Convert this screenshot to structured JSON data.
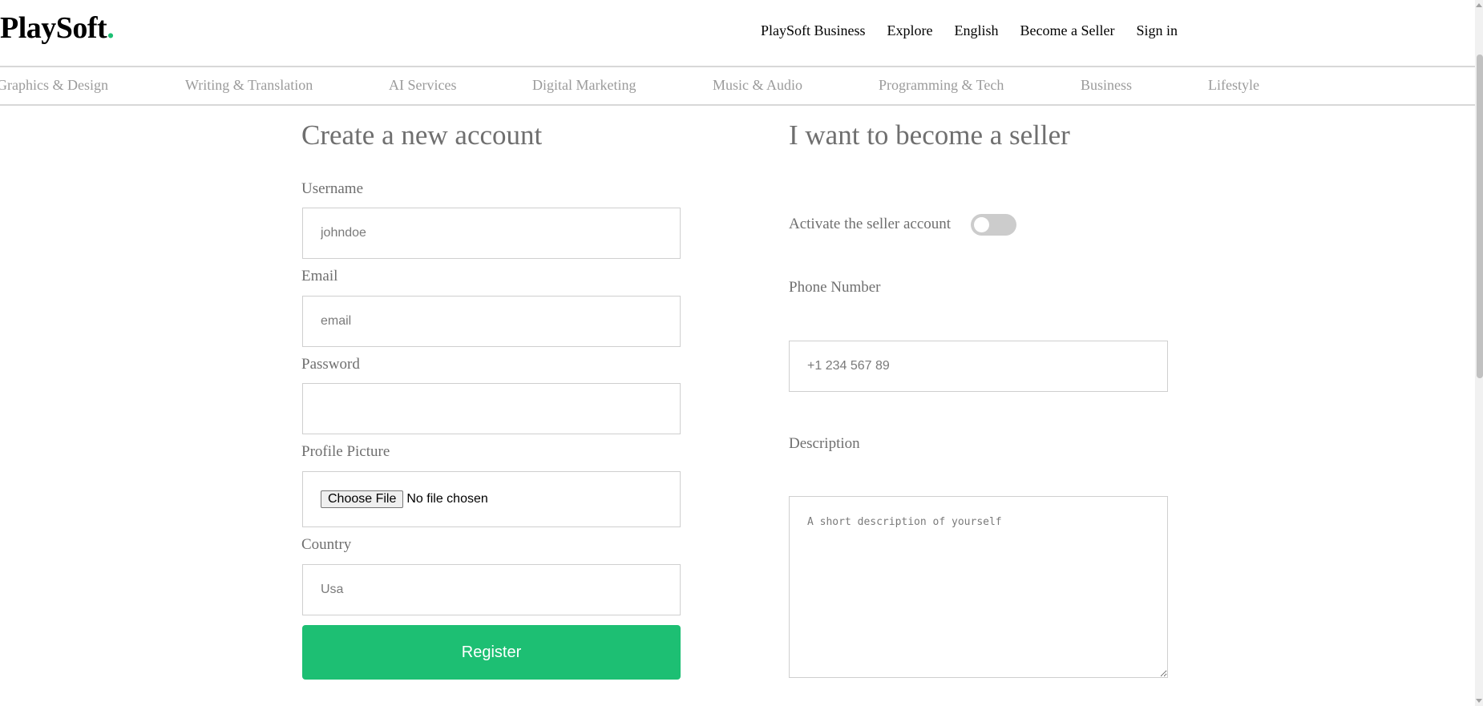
{
  "header": {
    "logo_text": "PlaySoft",
    "logo_dot": ".",
    "nav": [
      "PlaySoft Business",
      "Explore",
      "English",
      "Become a Seller",
      "Sign in"
    ]
  },
  "categories": [
    "Graphics & Design",
    "Writing & Translation",
    "AI Services",
    "Digital Marketing",
    "Music & Audio",
    "Programming & Tech",
    "Business",
    "Lifestyle"
  ],
  "register_form": {
    "title": "Create a new account",
    "username_label": "Username",
    "username_placeholder": "johndoe",
    "email_label": "Email",
    "email_placeholder": "email",
    "password_label": "Password",
    "profile_picture_label": "Profile Picture",
    "file_button": "Choose File",
    "file_status": "No file chosen",
    "country_label": "Country",
    "country_placeholder": "Usa",
    "register_button": "Register"
  },
  "seller_form": {
    "title": "I want to become a seller",
    "activate_label": "Activate the seller account",
    "activate_on": false,
    "phone_label": "Phone Number",
    "phone_placeholder": "+1 234 567 89",
    "description_label": "Description",
    "description_placeholder": "A short description of yourself"
  },
  "colors": {
    "accent": "#1dbf73",
    "toggle_off": "#cccccc"
  }
}
